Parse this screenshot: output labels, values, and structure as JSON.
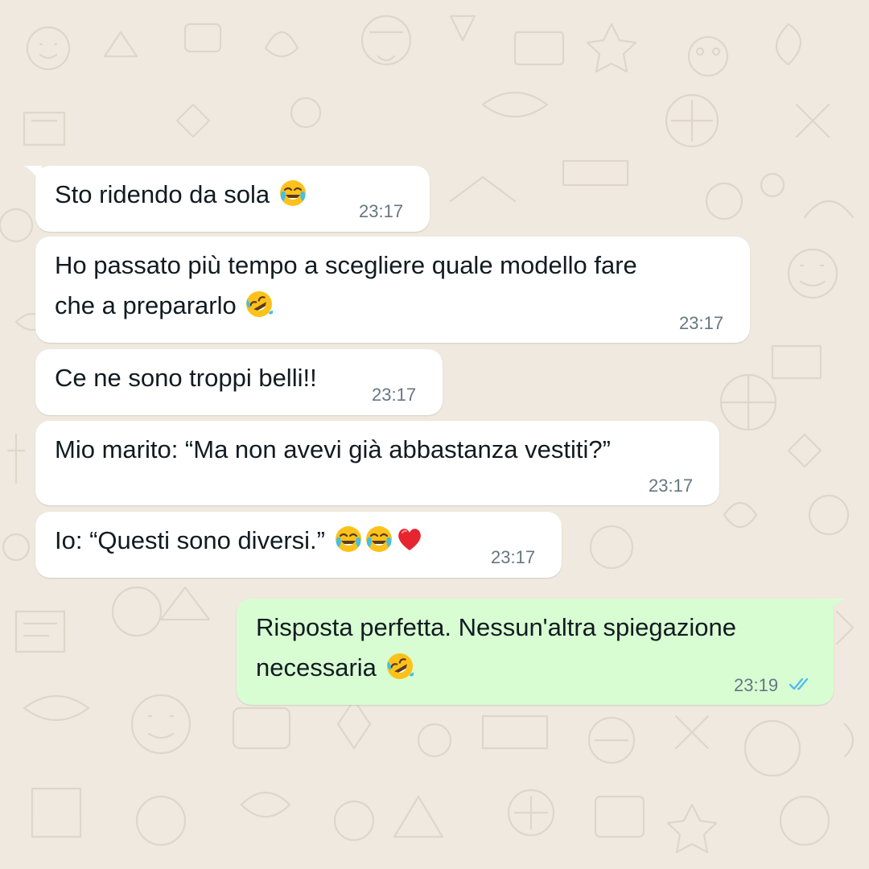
{
  "chat": {
    "messages": [
      {
        "direction": "incoming",
        "line1": "Sto ridendo da sola",
        "time": "23:17"
      },
      {
        "direction": "incoming",
        "line1": "Ho passato più tempo a scegliere quale modello fare",
        "line2": "che a prepararlo",
        "time": "23:17"
      },
      {
        "direction": "incoming",
        "line1": "Ce ne sono troppi belli!!",
        "time": "23:17"
      },
      {
        "direction": "incoming",
        "line1": "Mio marito: “Ma non avevi già abbastanza vestiti?”",
        "time": "23:17"
      },
      {
        "direction": "incoming",
        "line1": "Io: “Questi sono diversi.”",
        "time": "23:17"
      },
      {
        "direction": "outgoing",
        "line1": "Risposta perfetta. Nessun'altra spiegazione",
        "line2": "necessaria",
        "time": "23:19",
        "status": "read"
      }
    ]
  },
  "colors": {
    "incoming_bubble": "#ffffff",
    "outgoing_bubble": "#d9fdd3",
    "timestamp": "#667781",
    "read_ticks": "#53bdeb",
    "wallpaper": "#efe9df"
  },
  "icons": {
    "msg1": [
      "face-with-tears-of-joy"
    ],
    "msg2": [
      "rolling-on-the-floor-laughing"
    ],
    "msg5": [
      "face-with-tears-of-joy",
      "face-with-tears-of-joy",
      "red-heart"
    ],
    "msg6": [
      "rolling-on-the-floor-laughing"
    ],
    "status": "double-check-icon"
  }
}
